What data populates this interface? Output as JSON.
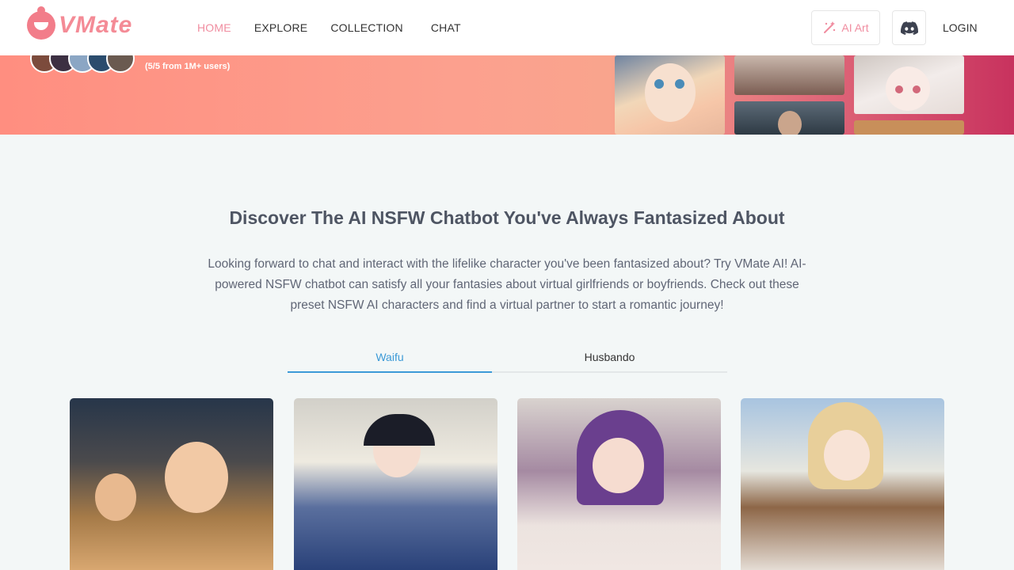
{
  "brand": {
    "name": "VMate",
    "color": "#f48b96"
  },
  "nav": {
    "home": "HOME",
    "explore": "EXPLORE",
    "collection": "COLLECTION",
    "chat": "CHAT"
  },
  "header_actions": {
    "ai_art_label": "AI Art",
    "ai_art_icon": "magic-wand-icon",
    "discord_icon": "discord-icon",
    "login_label": "LOGIN"
  },
  "banner": {
    "rating_text": "(5/5 from 1M+ users)"
  },
  "section": {
    "headline": "Discover The AI NSFW Chatbot You've Always Fantasized About",
    "description": "Looking forward to chat and interact with the lifelike character you've been fantasized about? Try VMate AI! AI-powered NSFW chatbot can satisfy all your fantasies about virtual girlfriends or boyfriends. Check out these preset NSFW AI characters and find a virtual partner to start a romantic journey!"
  },
  "tabs": [
    {
      "label": "Waifu",
      "active": true
    },
    {
      "label": "Husbando",
      "active": false
    }
  ],
  "colors": {
    "accent_pink": "#f08da0",
    "accent_blue": "#3c9ad7",
    "banner_start": "#ff8e80",
    "banner_end": "#c8325e"
  }
}
